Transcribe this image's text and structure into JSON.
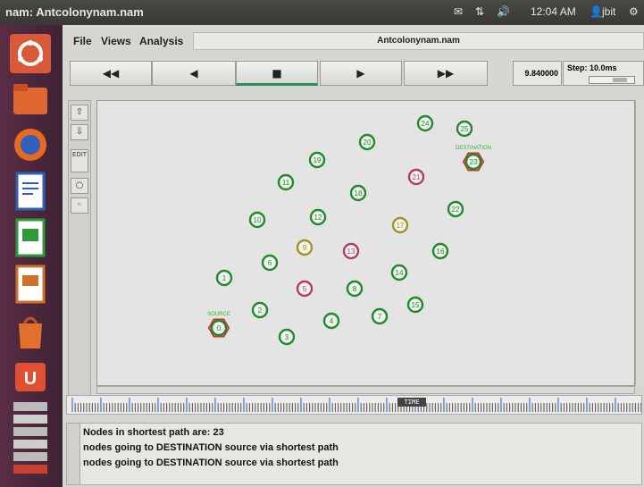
{
  "window_title": "nam: Antcolonynam.nam",
  "indicators": {
    "clock": "12:04 AM",
    "user": "jbit"
  },
  "menu": [
    "File",
    "Views",
    "Analysis"
  ],
  "file_name": "Antcolonynam.nam",
  "playback": {
    "rewind": "◀◀",
    "back": "◀",
    "stop": "■",
    "play": "▶",
    "fast_forward": "▶▶"
  },
  "time_value": "9.840000",
  "step_label": "Step: 10.0ms",
  "tools": [
    "EDIT"
  ],
  "timeline_marker": "TIME",
  "nodes": [
    {
      "id": "0",
      "color": "#c83228",
      "shape": "hexagon"
    },
    {
      "id": "1",
      "color": "#1e8c28"
    },
    {
      "id": "2",
      "color": "#1e8c28"
    },
    {
      "id": "3",
      "color": "#1e8c28"
    },
    {
      "id": "4",
      "color": "#1e8c28"
    },
    {
      "id": "5",
      "color": "#b43c64"
    },
    {
      "id": "6",
      "color": "#1e8c28"
    },
    {
      "id": "7",
      "color": "#1e8c28"
    },
    {
      "id": "8",
      "color": "#1e8c28"
    },
    {
      "id": "9",
      "color": "#a09628"
    },
    {
      "id": "10",
      "color": "#1e8c28"
    },
    {
      "id": "11",
      "color": "#1e8c28"
    },
    {
      "id": "12",
      "color": "#1e8c28"
    },
    {
      "id": "13",
      "color": "#b43c64"
    },
    {
      "id": "14",
      "color": "#1e8c28"
    },
    {
      "id": "15",
      "color": "#1e8c28"
    },
    {
      "id": "16",
      "color": "#1e8c28"
    },
    {
      "id": "17",
      "color": "#a09628"
    },
    {
      "id": "18",
      "color": "#1e8c28"
    },
    {
      "id": "19",
      "color": "#1e8c28"
    },
    {
      "id": "20",
      "color": "#1e8c28"
    },
    {
      "id": "21",
      "color": "#b43c64"
    },
    {
      "id": "22",
      "color": "#1e8c28"
    },
    {
      "id": "23",
      "color": "#c83228",
      "shape": "hexagon"
    },
    {
      "id": "24",
      "color": "#1e8c28"
    },
    {
      "id": "25",
      "color": "#1e8c28"
    }
  ],
  "node_labels": {
    "source": "SOURCE",
    "destination": "DESTINATION"
  },
  "log": [
    "Nodes in shortest path are: 23",
    "nodes going to DESTINATION source via shortest path",
    "nodes going to DESTINATION source via shortest path"
  ]
}
